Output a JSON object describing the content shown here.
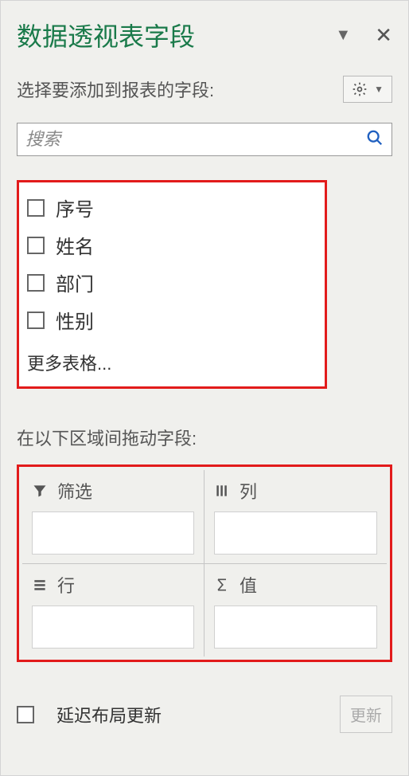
{
  "header": {
    "title": "数据透视表字段"
  },
  "subtitle": "选择要添加到报表的字段:",
  "search": {
    "placeholder": "搜索"
  },
  "fields": [
    {
      "label": "序号"
    },
    {
      "label": "姓名"
    },
    {
      "label": "部门"
    },
    {
      "label": "性别"
    }
  ],
  "more_tables": "更多表格...",
  "drag_label": "在以下区域间拖动字段:",
  "zones": {
    "filter": "筛选",
    "columns": "列",
    "rows": "行",
    "values": "值"
  },
  "footer": {
    "defer_label": "延迟布局更新",
    "update_button": "更新"
  }
}
